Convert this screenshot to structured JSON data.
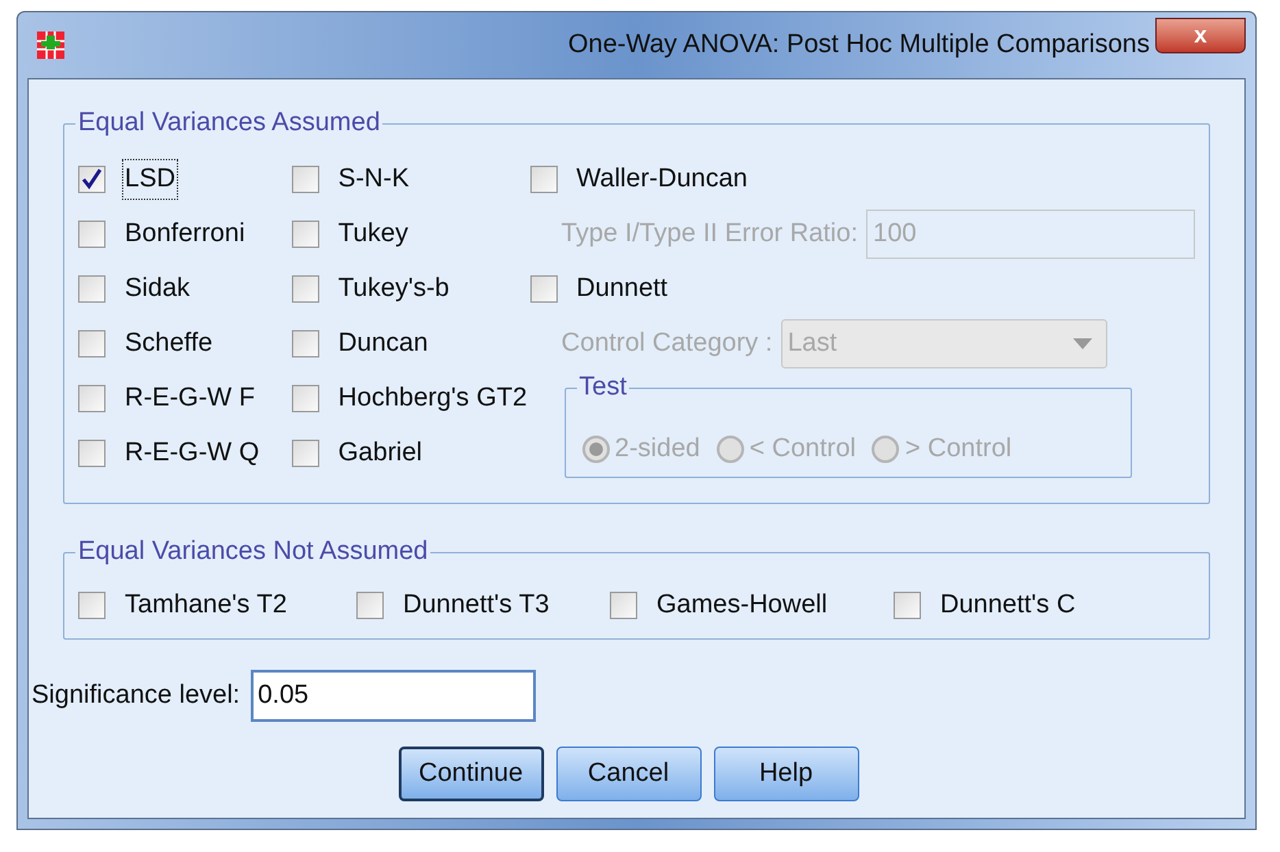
{
  "window": {
    "title": "One-Way ANOVA: Post Hoc Multiple Comparisons",
    "close": "x"
  },
  "equal_variances_assumed": {
    "title": "Equal Variances Assumed",
    "column_1": [
      {
        "label": "LSD",
        "checked": true,
        "focused": true
      },
      {
        "label": "Bonferroni",
        "checked": false,
        "focused": false
      },
      {
        "label": "Sidak",
        "checked": false,
        "focused": false
      },
      {
        "label": "Scheffe",
        "checked": false,
        "focused": false
      },
      {
        "label": "R-E-G-W F",
        "checked": false,
        "focused": false
      },
      {
        "label": "R-E-G-W Q",
        "checked": false,
        "focused": false
      }
    ],
    "column_2": [
      {
        "label": "S-N-K",
        "checked": false,
        "focused": false
      },
      {
        "label": "Tukey",
        "checked": false,
        "focused": false
      },
      {
        "label": "Tukey's-b",
        "checked": false,
        "focused": false
      },
      {
        "label": "Duncan",
        "checked": false,
        "focused": false
      },
      {
        "label": "Hochberg's GT2",
        "checked": false,
        "focused": false
      },
      {
        "label": "Gabriel",
        "checked": false,
        "focused": false
      }
    ],
    "waller_duncan": {
      "label": "Waller-Duncan",
      "checked": false,
      "focused": false
    },
    "error_ratio": {
      "label": "Type I/Type II Error Ratio:",
      "value": "100",
      "disabled": true
    },
    "dunnett": {
      "label": "Dunnett",
      "checked": false,
      "focused": false
    },
    "control_category": {
      "label": "Control Category :",
      "value": "Last",
      "disabled": true
    },
    "test": {
      "title": "Test",
      "disabled": true,
      "options": [
        {
          "label": "2-sided",
          "selected": true
        },
        {
          "label": "< Control",
          "selected": false
        },
        {
          "label": "> Control",
          "selected": false
        }
      ]
    }
  },
  "equal_variances_not_assumed": {
    "title": "Equal Variances Not Assumed",
    "items": [
      {
        "label": "Tamhane's T2",
        "checked": false,
        "focused": false
      },
      {
        "label": "Dunnett's T3",
        "checked": false,
        "focused": false
      },
      {
        "label": "Games-Howell",
        "checked": false,
        "focused": false
      },
      {
        "label": "Dunnett's C",
        "checked": false,
        "focused": false
      }
    ]
  },
  "significance": {
    "label": "Significance level:",
    "value": "0.05"
  },
  "buttons": [
    {
      "label": "Continue",
      "default": true
    },
    {
      "label": "Cancel",
      "default": false
    },
    {
      "label": "Help",
      "default": false
    }
  ]
}
